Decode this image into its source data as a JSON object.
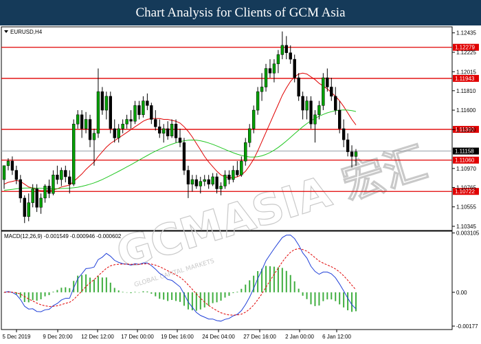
{
  "header": {
    "title": "Chart Analysis for Clients of GCM Asia"
  },
  "chart_data": {
    "type": "candlestick",
    "symbol_label": "EURUSD,H4",
    "macd_label": "MACD(12,26,9) -0.001549 -0.000946 -0.000602",
    "watermark": "GCMASIA 宏汇",
    "watermark_sub": "GLOBAL CAPITAL MARKETS",
    "price_ticks": [
      "1.12435",
      "1.12225",
      "1.12015",
      "1.11810",
      "1.11600",
      "1.11390",
      "1.10970",
      "1.10765",
      "1.10555",
      "1.10345"
    ],
    "price_ylim": [
      1.103,
      1.125
    ],
    "current_price": {
      "label": "1.11158",
      "value": 1.11158
    },
    "levels": [
      {
        "label": "1.12279",
        "value": 1.12279
      },
      {
        "label": "1.11943",
        "value": 1.11943
      },
      {
        "label": "1.11392",
        "value": 1.11392
      },
      {
        "label": "1.11060",
        "value": 1.1106
      },
      {
        "label": "1.10722",
        "value": 1.10722
      }
    ],
    "x_ticks": [
      "5 Dec 2019",
      "9 Dec 20:00",
      "12 Dec 12:00",
      "17 Dec 00:00",
      "19 Dec 16:00",
      "24 Dec 04:00",
      "27 Dec 16:00",
      "2 Jan 00:00",
      "6 Jan 12:00"
    ],
    "macd_ticks": [
      "0.003105",
      "0.00",
      "-0.00177"
    ],
    "macd_ylim": [
      -0.00195,
      0.0032
    ],
    "candles": [
      [
        1.1085,
        1.11,
        1.1075,
        1.11
      ],
      [
        1.11,
        1.1108,
        1.1095,
        1.1105
      ],
      [
        1.1105,
        1.111,
        1.109,
        1.1095
      ],
      [
        1.1095,
        1.11,
        1.108,
        1.1085
      ],
      [
        1.1085,
        1.109,
        1.106,
        1.1065
      ],
      [
        1.1065,
        1.1068,
        1.1038,
        1.1045
      ],
      [
        1.1045,
        1.107,
        1.104,
        1.106
      ],
      [
        1.106,
        1.108,
        1.1055,
        1.1075
      ],
      [
        1.1075,
        1.108,
        1.105,
        1.1055
      ],
      [
        1.1055,
        1.107,
        1.1048,
        1.1065
      ],
      [
        1.1065,
        1.108,
        1.106,
        1.1078
      ],
      [
        1.1078,
        1.1085,
        1.1065,
        1.107
      ],
      [
        1.107,
        1.1095,
        1.1068,
        1.109
      ],
      [
        1.109,
        1.11,
        1.108,
        1.1085
      ],
      [
        1.1085,
        1.1098,
        1.1078,
        1.1095
      ],
      [
        1.1095,
        1.11,
        1.1082,
        1.1088
      ],
      [
        1.1088,
        1.1095,
        1.107,
        1.108
      ],
      [
        1.108,
        1.115,
        1.1078,
        1.1145
      ],
      [
        1.1145,
        1.116,
        1.114,
        1.1155
      ],
      [
        1.1155,
        1.116,
        1.113,
        1.114
      ],
      [
        1.114,
        1.1158,
        1.1135,
        1.115
      ],
      [
        1.115,
        1.1155,
        1.112,
        1.1128
      ],
      [
        1.1128,
        1.114,
        1.11,
        1.1135
      ],
      [
        1.1135,
        1.1205,
        1.113,
        1.118
      ],
      [
        1.118,
        1.1185,
        1.1155,
        1.116
      ],
      [
        1.116,
        1.118,
        1.115,
        1.1175
      ],
      [
        1.1175,
        1.118,
        1.1135,
        1.114
      ],
      [
        1.114,
        1.115,
        1.1125,
        1.113
      ],
      [
        1.113,
        1.1145,
        1.1125,
        1.114
      ],
      [
        1.114,
        1.115,
        1.1135,
        1.1145
      ],
      [
        1.1145,
        1.1155,
        1.114,
        1.115
      ],
      [
        1.115,
        1.116,
        1.114,
        1.1148
      ],
      [
        1.1148,
        1.117,
        1.1145,
        1.1165
      ],
      [
        1.1165,
        1.117,
        1.115,
        1.1155
      ],
      [
        1.1155,
        1.1175,
        1.1152,
        1.117
      ],
      [
        1.117,
        1.1178,
        1.116,
        1.1165
      ],
      [
        1.1165,
        1.1168,
        1.1145,
        1.115
      ],
      [
        1.115,
        1.116,
        1.1138,
        1.1142
      ],
      [
        1.1142,
        1.115,
        1.113,
        1.1135
      ],
      [
        1.1135,
        1.1145,
        1.1125,
        1.114
      ],
      [
        1.114,
        1.1148,
        1.1128,
        1.1132
      ],
      [
        1.1132,
        1.115,
        1.113,
        1.1145
      ],
      [
        1.1145,
        1.115,
        1.1125,
        1.113
      ],
      [
        1.113,
        1.114,
        1.112,
        1.1125
      ],
      [
        1.1125,
        1.113,
        1.109,
        1.1095
      ],
      [
        1.1095,
        1.11,
        1.1065,
        1.108
      ],
      [
        1.108,
        1.109,
        1.1072,
        1.1085
      ],
      [
        1.1085,
        1.109,
        1.1075,
        1.1078
      ],
      [
        1.1078,
        1.1088,
        1.107,
        1.1083
      ],
      [
        1.1083,
        1.109,
        1.1078,
        1.1085
      ],
      [
        1.1085,
        1.109,
        1.1075,
        1.108
      ],
      [
        1.108,
        1.1092,
        1.1078,
        1.1088
      ],
      [
        1.1088,
        1.1092,
        1.107,
        1.1075
      ],
      [
        1.1075,
        1.1082,
        1.1068,
        1.1078
      ],
      [
        1.1078,
        1.1095,
        1.1075,
        1.109
      ],
      [
        1.109,
        1.1095,
        1.108,
        1.1085
      ],
      [
        1.1085,
        1.11,
        1.1082,
        1.1095
      ],
      [
        1.1095,
        1.1105,
        1.1088,
        1.109
      ],
      [
        1.109,
        1.111,
        1.1088,
        1.1105
      ],
      [
        1.1105,
        1.113,
        1.11,
        1.1125
      ],
      [
        1.1125,
        1.1145,
        1.112,
        1.114
      ],
      [
        1.114,
        1.1165,
        1.1135,
        1.116
      ],
      [
        1.116,
        1.1185,
        1.1155,
        1.118
      ],
      [
        1.118,
        1.12,
        1.117,
        1.1185
      ],
      [
        1.1185,
        1.121,
        1.118,
        1.1205
      ],
      [
        1.1205,
        1.1215,
        1.1195,
        1.12
      ],
      [
        1.12,
        1.1215,
        1.119,
        1.121
      ],
      [
        1.121,
        1.1225,
        1.12,
        1.122
      ],
      [
        1.122,
        1.1245,
        1.1215,
        1.123
      ],
      [
        1.123,
        1.124,
        1.1215,
        1.1222
      ],
      [
        1.1222,
        1.123,
        1.121,
        1.1215
      ],
      [
        1.1215,
        1.122,
        1.119,
        1.1195
      ],
      [
        1.1195,
        1.12,
        1.117,
        1.1175
      ],
      [
        1.1175,
        1.118,
        1.115,
        1.116
      ],
      [
        1.116,
        1.1175,
        1.115,
        1.117
      ],
      [
        1.117,
        1.1175,
        1.114,
        1.1145
      ],
      [
        1.1145,
        1.116,
        1.1125,
        1.1155
      ],
      [
        1.1155,
        1.117,
        1.115,
        1.1165
      ],
      [
        1.1165,
        1.12,
        1.116,
        1.1195
      ],
      [
        1.1195,
        1.1205,
        1.118,
        1.1185
      ],
      [
        1.1185,
        1.1195,
        1.117,
        1.1175
      ],
      [
        1.1175,
        1.1185,
        1.1155,
        1.116
      ],
      [
        1.116,
        1.117,
        1.1135,
        1.114
      ],
      [
        1.114,
        1.115,
        1.112,
        1.1128
      ],
      [
        1.1128,
        1.1135,
        1.111,
        1.1115
      ],
      [
        1.1115,
        1.1122,
        1.1098,
        1.111
      ],
      [
        1.111,
        1.1118,
        1.11,
        1.1115
      ]
    ],
    "sma_red": [
      1.108,
      1.1082,
      1.1083,
      1.1084,
      1.1083,
      1.108,
      1.1077,
      1.1076,
      1.1074,
      1.1073,
      1.1073,
      1.1073,
      1.1074,
      1.1075,
      1.1077,
      1.1078,
      1.1079,
      1.1083,
      1.1087,
      1.1091,
      1.1096,
      1.11,
      1.1104,
      1.111,
      1.1115,
      1.112,
      1.1124,
      1.1127,
      1.113,
      1.1133,
      1.1136,
      1.1139,
      1.1142,
      1.1145,
      1.1148,
      1.115,
      1.1151,
      1.1151,
      1.1151,
      1.115,
      1.115,
      1.1149,
      1.1148,
      1.1146,
      1.1142,
      1.1137,
      1.1131,
      1.1124,
      1.1117,
      1.111,
      1.1104,
      1.1099,
      1.1094,
      1.109,
      1.1088,
      1.1087,
      1.1087,
      1.1088,
      1.109,
      1.1094,
      1.11,
      1.1107,
      1.1116,
      1.1126,
      1.1136,
      1.1146,
      1.1156,
      1.1166,
      1.1176,
      1.1184,
      1.1191,
      1.1196,
      1.1199,
      1.12,
      1.1199,
      1.1196,
      1.1193,
      1.1189,
      1.1186,
      1.1183,
      1.1179,
      1.1175,
      1.117,
      1.1164,
      1.1157,
      1.115,
      1.1144
    ]
  }
}
